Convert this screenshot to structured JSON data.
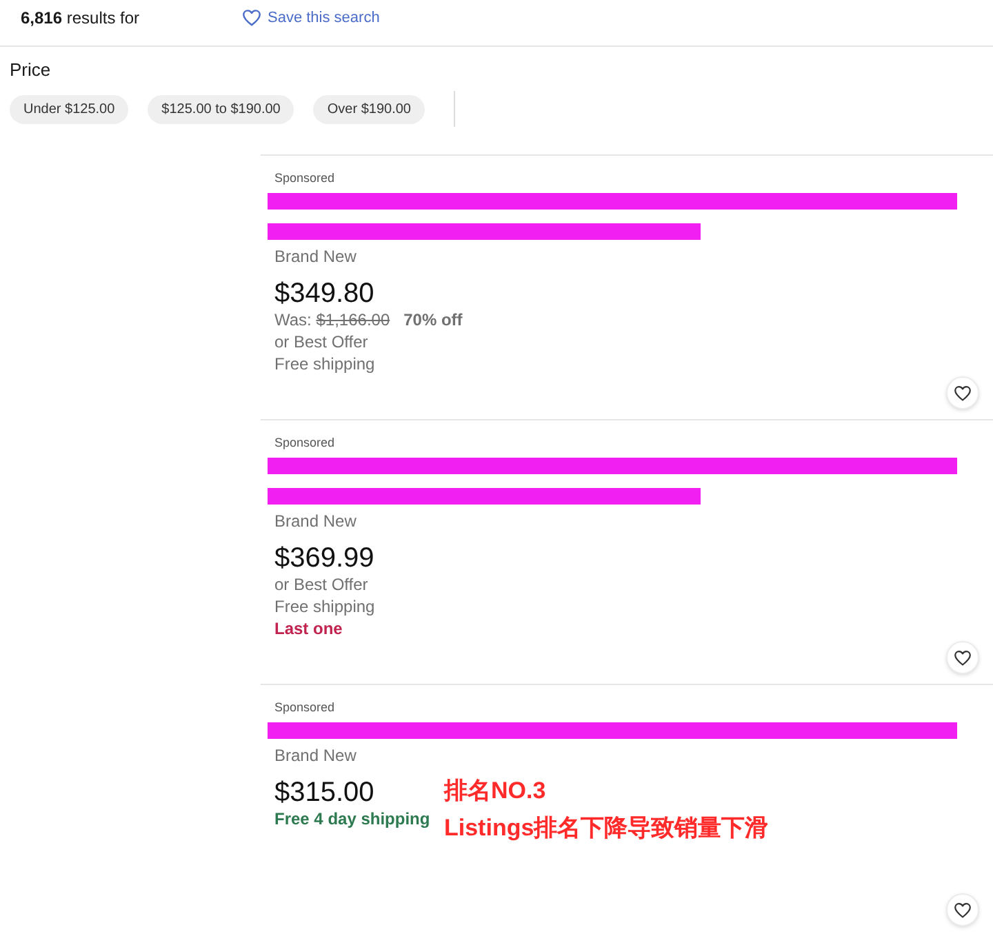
{
  "results_header": {
    "summary": "**6,816** results for",
    "save_search": "Save this search"
  },
  "price_filter": {
    "heading": "Price",
    "options": [
      {
        "label": "Under $125.00",
        "selected": false
      },
      {
        "label": "$125.00 to $190.00",
        "selected": false
      },
      {
        "label": "Over $190.00",
        "selected": false
      }
    ]
  },
  "listings": [
    {
      "sponsored": "Sponsored",
      "title_redactions": [
        {
          "kind": "full"
        },
        {
          "kind": "partial"
        }
      ],
      "condition": "Brand New",
      "price": "$349.80",
      "was": {
        "label": "Was:",
        "price": "$1,166.00",
        "discount": "70% off"
      },
      "offer": "or Best Offer",
      "shipping": {
        "text": "Free shipping",
        "kind": "standard"
      }
    },
    {
      "sponsored": "Sponsored",
      "title_redactions": [
        {
          "kind": "full"
        },
        {
          "kind": "partial"
        }
      ],
      "condition": "Brand New",
      "price": "$369.99",
      "offer": "or Best Offer",
      "shipping": {
        "text": "Free shipping",
        "kind": "standard"
      },
      "stock_note": "Last one"
    },
    {
      "sponsored": "Sponsored",
      "title_redactions": [
        {
          "kind": "full"
        }
      ],
      "condition": "Brand New",
      "price": "$315.00",
      "shipping": {
        "text": "Free 4 day shipping",
        "kind": "fast"
      },
      "overlay_note": [
        "排名NO.3",
        "Listings排名下降导致销量下滑"
      ]
    }
  ]
}
